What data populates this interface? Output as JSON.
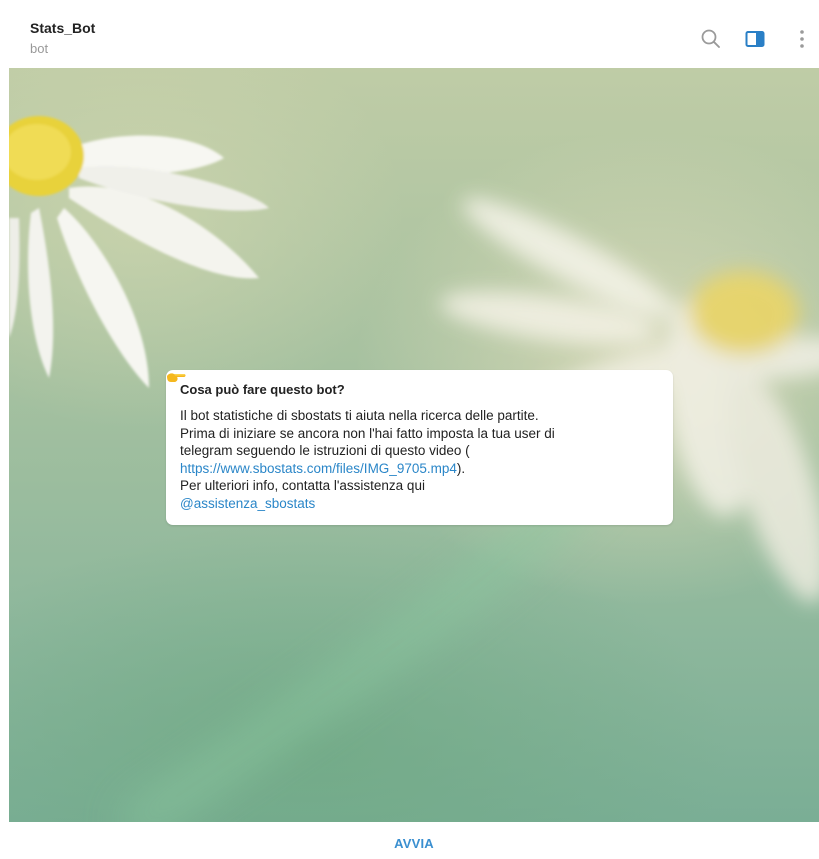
{
  "header": {
    "title": "Stats_Bot",
    "subtitle": "bot",
    "icons": [
      "search-icon",
      "side-panel-icon",
      "more-vertical-icon"
    ]
  },
  "info_card": {
    "title": "Cosa può fare questo bot?",
    "line1": "Il bot statistiche di sbostats ti aiuta nella ricerca delle partite.",
    "line2": "Prima di iniziare se ancora non l'hai fatto imposta la tua user di",
    "line3": "telegram seguendo le istruzioni di questo video (",
    "link_url": "https://www.sbostats.com/files/IMG_9705.mp4",
    "after_link": ").",
    "line5": "Per ulteriori info, contatta l'assistenza qui",
    "emoji_icon": "pointing-right-hand-icon",
    "mention": "@assistenza_sbostats"
  },
  "bottom": {
    "start_label": "AVVIA"
  },
  "colors": {
    "accent": "#3a8fd0",
    "link": "#2a86c8",
    "icon_blue": "#2a7fc6",
    "icon_gray": "#9a9a9a"
  }
}
